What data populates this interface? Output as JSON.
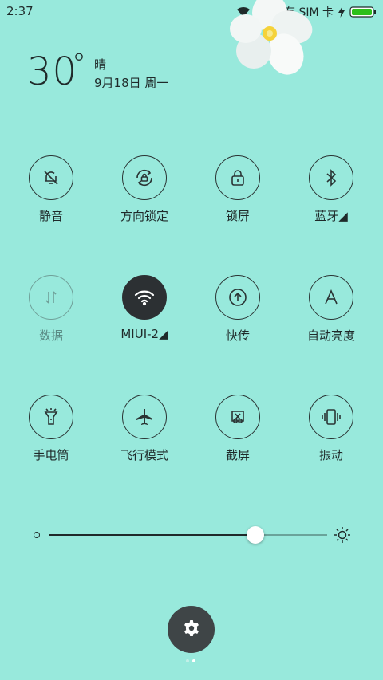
{
  "status_bar": {
    "time": "2:37",
    "sim_text": "没有 SIM 卡",
    "icons": [
      "wifi-icon",
      "no-sim-icon",
      "charging-icon",
      "battery-icon"
    ],
    "battery_color": "#2dbf1a"
  },
  "weather": {
    "temperature": "30",
    "degree_symbol": "°",
    "condition": "晴",
    "date": "9月18日 周一"
  },
  "toggles": [
    {
      "label": "静音",
      "icon": "bell-off-icon",
      "state": "off"
    },
    {
      "label": "方向锁定",
      "icon": "rotation-lock-icon",
      "state": "off"
    },
    {
      "label": "锁屏",
      "icon": "lock-icon",
      "state": "off"
    },
    {
      "label": "蓝牙◢",
      "icon": "bluetooth-icon",
      "state": "off"
    },
    {
      "label": "数据",
      "icon": "mobile-data-icon",
      "state": "disabled"
    },
    {
      "label": "MIUI-2◢",
      "icon": "wifi-icon",
      "state": "on"
    },
    {
      "label": "快传",
      "icon": "fast-transfer-icon",
      "state": "off"
    },
    {
      "label": "自动亮度",
      "icon": "auto-brightness-icon",
      "state": "off"
    },
    {
      "label": "手电筒",
      "icon": "flashlight-icon",
      "state": "off"
    },
    {
      "label": "飞行模式",
      "icon": "airplane-icon",
      "state": "off"
    },
    {
      "label": "截屏",
      "icon": "screenshot-icon",
      "state": "off"
    },
    {
      "label": "振动",
      "icon": "vibrate-icon",
      "state": "off"
    }
  ],
  "brightness": {
    "level": 0.74,
    "low_icon": "brightness-low-icon",
    "high_icon": "brightness-high-icon"
  },
  "settings_button": {
    "icon": "gear-icon"
  },
  "pager": {
    "pages": 2,
    "current": 2
  },
  "colors": {
    "background": "#98E9DC",
    "active_toggle": "#2c3033",
    "settings_button": "#3f4547"
  }
}
